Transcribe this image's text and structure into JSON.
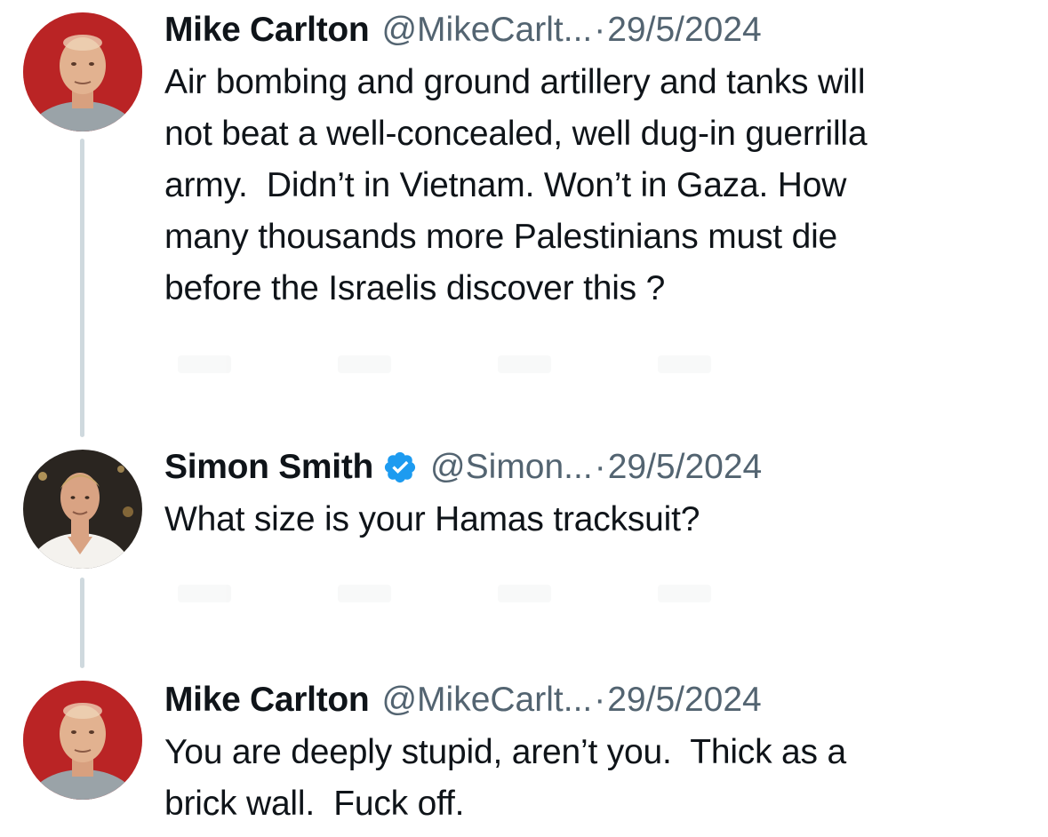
{
  "thread": {
    "tweets": [
      {
        "name": "Mike Carlton",
        "handle": "@MikeCarlt...",
        "separator": "·",
        "date": "29/5/2024",
        "verified": false,
        "avatar_icon": "avatar-mike-carlton",
        "text": "Air bombing and ground artillery and tanks will\nnot beat a well-concealed, well dug-in guerrilla\narmy.  Didn’t in Vietnam. Won’t in Gaza. How\nmany thousands more Palestinians must die\nbefore the Israelis discover this ?"
      },
      {
        "name": "Simon Smith",
        "handle": "@Simon...",
        "separator": "·",
        "date": "29/5/2024",
        "verified": true,
        "avatar_icon": "avatar-simon-smith",
        "text": "What size is your Hamas tracksuit?"
      },
      {
        "name": "Mike Carlton",
        "handle": "@MikeCarlt...",
        "separator": "·",
        "date": "29/5/2024",
        "verified": false,
        "avatar_icon": "avatar-mike-carlton",
        "text": "You are deeply stupid, aren’t you.  Thick as a\nbrick wall.  Fuck off."
      }
    ]
  },
  "colors": {
    "text_primary": "#0f1419",
    "text_secondary": "#536471",
    "thread_line": "#cfd9de",
    "verified_badge": "#1d9bf0",
    "avatar_background_red": "#c0282a"
  },
  "icons": {
    "verified": "verified-badge-icon"
  }
}
